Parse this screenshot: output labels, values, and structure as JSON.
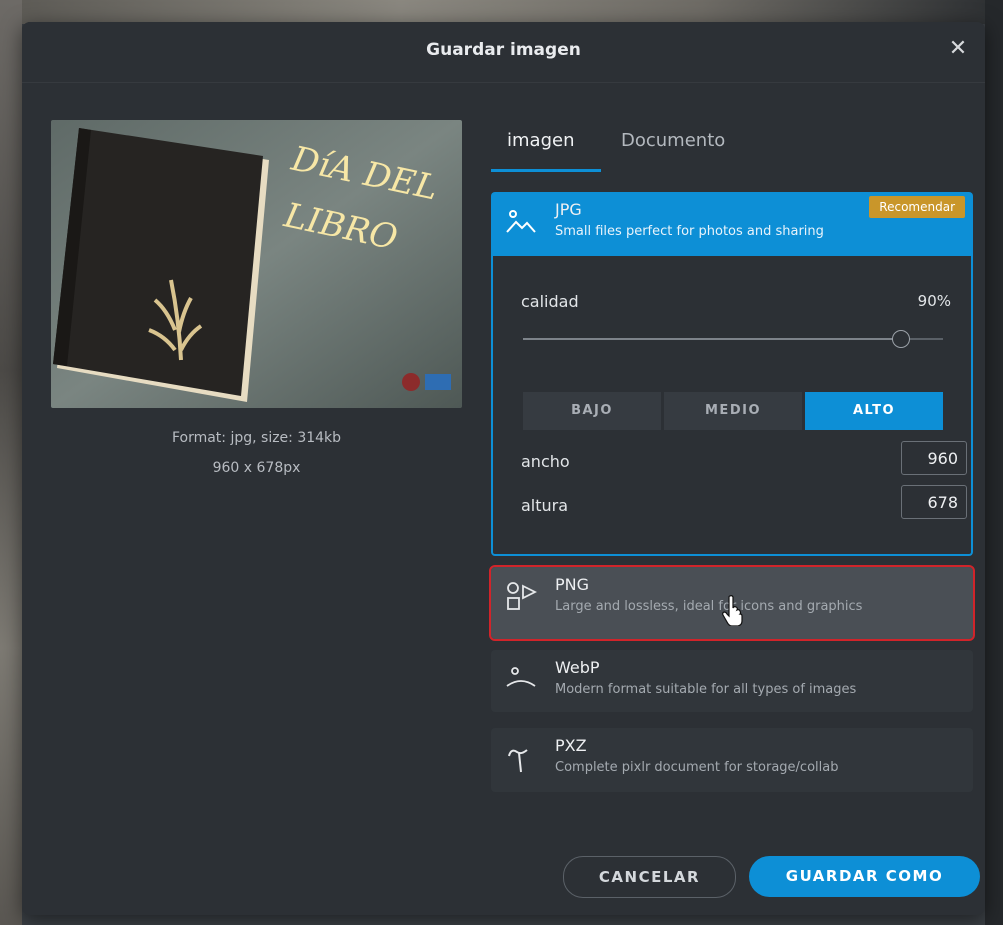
{
  "dialog": {
    "title": "Guardar imagen",
    "close_glyph": "✕"
  },
  "preview": {
    "image_text_line1": "DíA DEL",
    "image_text_line2": "LIBRO",
    "format_info": "Format: jpg, size: 314kb",
    "dimensions_info": "960 x 678px"
  },
  "tabs": [
    {
      "label": "imagen",
      "active": true
    },
    {
      "label": "Documento",
      "active": false
    }
  ],
  "formats": {
    "jpg": {
      "title": "JPG",
      "desc": "Small files perfect for photos and sharing",
      "badge": "Recomendar",
      "icon": "landscape-icon"
    },
    "png": {
      "title": "PNG",
      "desc": "Large and lossless, ideal for icons and graphics",
      "icon": "shapes-icon"
    },
    "webp": {
      "title": "WebP",
      "desc": "Modern format suitable for all types of images",
      "icon": "webp-icon"
    },
    "pxz": {
      "title": "PXZ",
      "desc": "Complete pixlr document for storage/collab",
      "icon": "pen-nib-icon"
    }
  },
  "jpg_options": {
    "quality_label": "calidad",
    "quality_value": "90%",
    "quality_fraction": 0.9,
    "presets": [
      "BAJO",
      "MEDIO",
      "ALTO"
    ],
    "active_preset": "ALTO",
    "width_label": "ancho",
    "width_value": "960",
    "height_label": "altura",
    "height_value": "678"
  },
  "buttons": {
    "cancel": "CANCELAR",
    "save": "GUARDAR COMO"
  },
  "colors": {
    "accent": "#0d8fd6",
    "badge": "#c9962a",
    "highlight_border": "#d1242a"
  }
}
